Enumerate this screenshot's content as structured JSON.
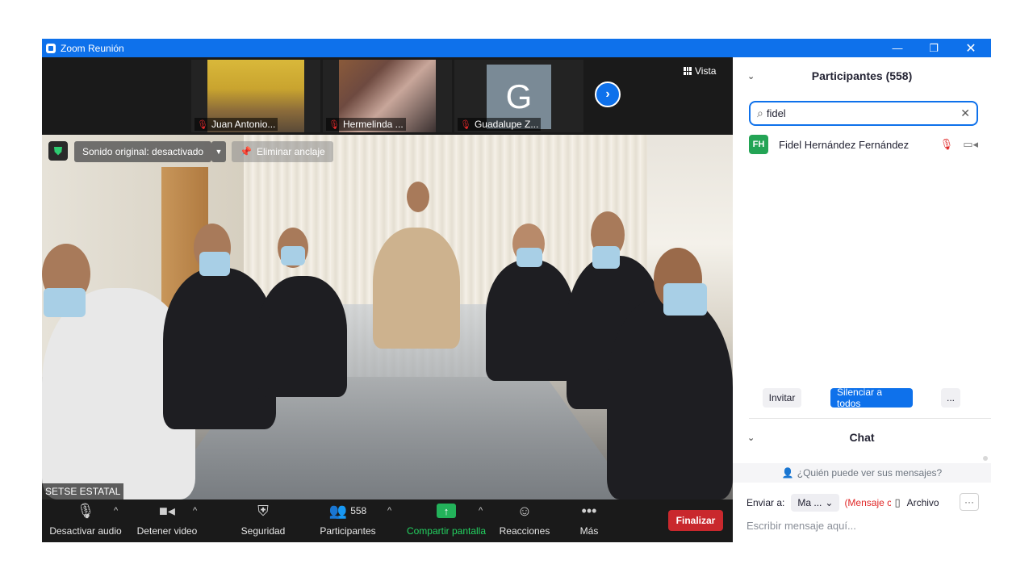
{
  "window": {
    "title": "Zoom Reunión",
    "controls": {
      "minimize": "—",
      "maximize": "❐",
      "close": "✕"
    }
  },
  "thumbnails": [
    {
      "name": "Juan Antonio...",
      "muted": true
    },
    {
      "name": "Hermelinda ...",
      "muted": true
    },
    {
      "name": "Guadalupe Z...",
      "muted": true,
      "avatar_letter": "G"
    }
  ],
  "view_button": {
    "label": "Vista"
  },
  "main_video": {
    "original_sound": "Sonido original: desactivado",
    "unpin": "Eliminar anclaje",
    "name_tag": "SETSE ESTATAL"
  },
  "toolbar": {
    "audio": "Desactivar audio",
    "video": "Detener video",
    "security": "Seguridad",
    "participants": "Participantes",
    "participants_count": "558",
    "share": "Compartir pantalla",
    "reactions": "Reacciones",
    "more": "Más",
    "end": "Finalizar",
    "share_color": "#23b25a",
    "end_color": "#c9282d"
  },
  "panel": {
    "participants_title": "Participantes (558)",
    "search_value": "fidel",
    "results": [
      {
        "initials": "FH",
        "name": "Fidel Hernández Fernández",
        "avatar_color": "#23a455",
        "muted": true
      }
    ],
    "invite": "Invitar",
    "mute_all": "Silenciar a todos",
    "more": "...",
    "chat_title": "Chat",
    "who_can_see": "¿Quién puede ver sus mensajes?",
    "send_to_label": "Enviar a:",
    "send_to_value": "Ma ...",
    "private_note": "(Mensaje c",
    "file_label": "Archivo",
    "message_placeholder": "Escribir mensaje aquí..."
  },
  "accent_color": "#0e71eb"
}
